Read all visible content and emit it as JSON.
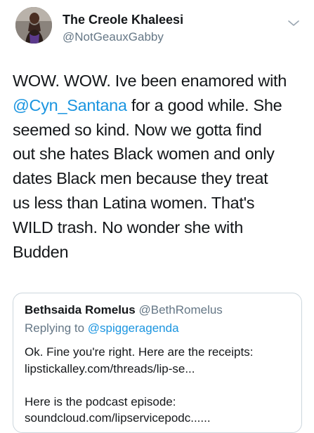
{
  "tweet": {
    "author": {
      "display_name": "The Creole Khaleesi",
      "handle": "@NotGeauxGabby",
      "avatar_icon": "profile-photo-avatar"
    },
    "menu_icon": "chevron-down-icon",
    "text_lines": [
      {
        "before": "WOW. WOW. Ive been enamored with",
        "mention": "",
        "after": ""
      },
      {
        "before": "",
        "mention": "@Cyn_Santana",
        "after": " for a good while. She"
      },
      {
        "before": "seemed so kind. Now we gotta find",
        "mention": "",
        "after": ""
      },
      {
        "before": "out she hates Black women and only",
        "mention": "",
        "after": ""
      },
      {
        "before": "dates Black men because they treat",
        "mention": "",
        "after": ""
      },
      {
        "before": "us less than Latina women. That's",
        "mention": "",
        "after": ""
      },
      {
        "before": "WILD trash. No wonder she with",
        "mention": "",
        "after": ""
      },
      {
        "before": "Budden",
        "mention": "",
        "after": ""
      }
    ],
    "colors": {
      "link": "#1b95e0",
      "secondary_text": "#657786",
      "border": "#ccd6dd"
    }
  },
  "quoted_tweet": {
    "display_name": "Bethsaida Romelus",
    "handle": "@BethRomelus",
    "replying_to_prefix": "Replying to ",
    "replying_to_handle": "@spiggeragenda",
    "body_lines": [
      "Ok. Fine you're right. Here are the receipts:",
      "lipstickalley.com/threads/lip-se...",
      "",
      "Here is the podcast episode:",
      "soundcloud.com/lipservicepodc......"
    ]
  }
}
